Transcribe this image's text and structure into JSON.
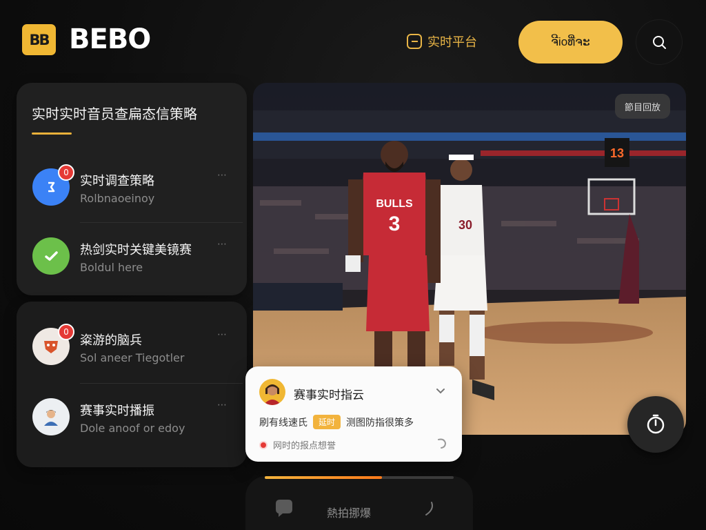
{
  "header": {
    "logo_mark": "BB",
    "logo_text": "BEBO",
    "live_link": "实时平台",
    "cta_label": "ຈີ​ioທີ່ຈະ",
    "search_icon": "search-icon"
  },
  "strategy_panel": {
    "title": "实时实时音员查扁态信策略",
    "items": [
      {
        "title": "实时调查策略",
        "subtitle": "Rolbnaoeinoy",
        "badge": "0",
        "avatar_color": "#3b82f6",
        "more": "⋯"
      },
      {
        "title": "热剑实时关键美镜赛",
        "subtitle": "Boldul here",
        "avatar_color": "#6cc04a",
        "more": "⋯"
      }
    ]
  },
  "recommend_panel": {
    "items": [
      {
        "title": "粢游的脑兵",
        "subtitle": "Sol aneer Tiegotler",
        "badge": "0",
        "more": "⋯"
      },
      {
        "title": "赛事实时播振",
        "subtitle": "Dole anoof or edoy",
        "more": "⋯"
      }
    ]
  },
  "video": {
    "badge": "節目回放",
    "scoreboard": "13",
    "player_1_jersey": "3",
    "player_1_team": "BULLS",
    "player_2_jersey": "30"
  },
  "event_card": {
    "title": "赛事实时指云",
    "line_left": "刷有线速氏",
    "tag": "延时",
    "line_right": "测图防指很策多",
    "footer": "网时的报点想誉"
  },
  "bottom_bar": {
    "label": "熱拍挪爆",
    "progress": 0.62
  },
  "colors": {
    "accent": "#f2bf4a",
    "background": "#0e0e0e",
    "panel": "#202020",
    "badge": "#e53935"
  }
}
